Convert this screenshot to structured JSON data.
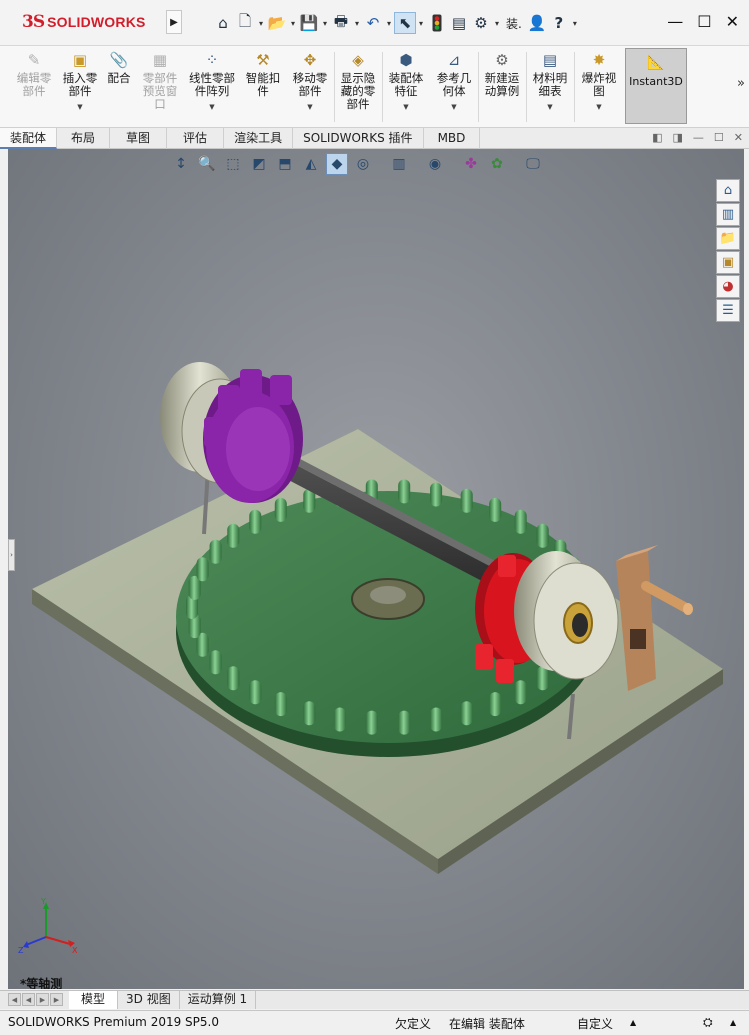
{
  "app": {
    "brand_ds": "3S",
    "brand_name": "SOLIDWORKS",
    "quick_text": "装."
  },
  "ribbon": {
    "buttons": [
      {
        "label": "编辑零\n部件",
        "icon": "edit-component-icon",
        "disabled": true
      },
      {
        "label": "插入零\n部件",
        "icon": "insert-component-icon",
        "disabled": false
      },
      {
        "label": "配合",
        "icon": "mate-paperclip-icon",
        "disabled": false
      },
      {
        "label": "零部件\n预览窗\n口",
        "icon": "component-preview-icon",
        "disabled": true
      },
      {
        "label": "线性零部\n件阵列",
        "icon": "linear-pattern-icon",
        "disabled": false
      },
      {
        "label": "智能扣\n件",
        "icon": "smart-fasteners-icon",
        "disabled": false
      },
      {
        "label": "移动零\n部件",
        "icon": "move-component-icon",
        "disabled": false
      },
      {
        "label": "显示隐\n藏的零\n部件",
        "icon": "show-hidden-icon",
        "disabled": false
      },
      {
        "label": "装配体\n特征",
        "icon": "assembly-features-icon",
        "disabled": false
      },
      {
        "label": "参考几\n何体",
        "icon": "reference-geometry-icon",
        "disabled": false
      },
      {
        "label": "新建运\n动算例",
        "icon": "motion-study-icon",
        "disabled": false
      },
      {
        "label": "材料明\n细表",
        "icon": "bom-icon",
        "disabled": false
      },
      {
        "label": "爆炸视\n图",
        "icon": "exploded-view-icon",
        "disabled": false
      }
    ],
    "instant3d": "Instant3D"
  },
  "tabs": [
    "装配体",
    "布局",
    "草图",
    "评估",
    "渲染工具",
    "SOLIDWORKS 插件",
    "MBD"
  ],
  "model_tabs": [
    "模型",
    "3D 视图",
    "运动算例 1"
  ],
  "viewport": {
    "view_name": "*等轴测"
  },
  "status": {
    "product": "SOLIDWORKS Premium 2019 SP5.0",
    "definition": "欠定义",
    "editing": "在编辑 装配体",
    "units": "自定义"
  },
  "colors": {
    "accent": "#5a7fb0",
    "logo_red": "#d31d2a",
    "gear_green": "#3f7a4c",
    "pinion_purple": "#8a24a8",
    "gear_red": "#d8151f"
  }
}
